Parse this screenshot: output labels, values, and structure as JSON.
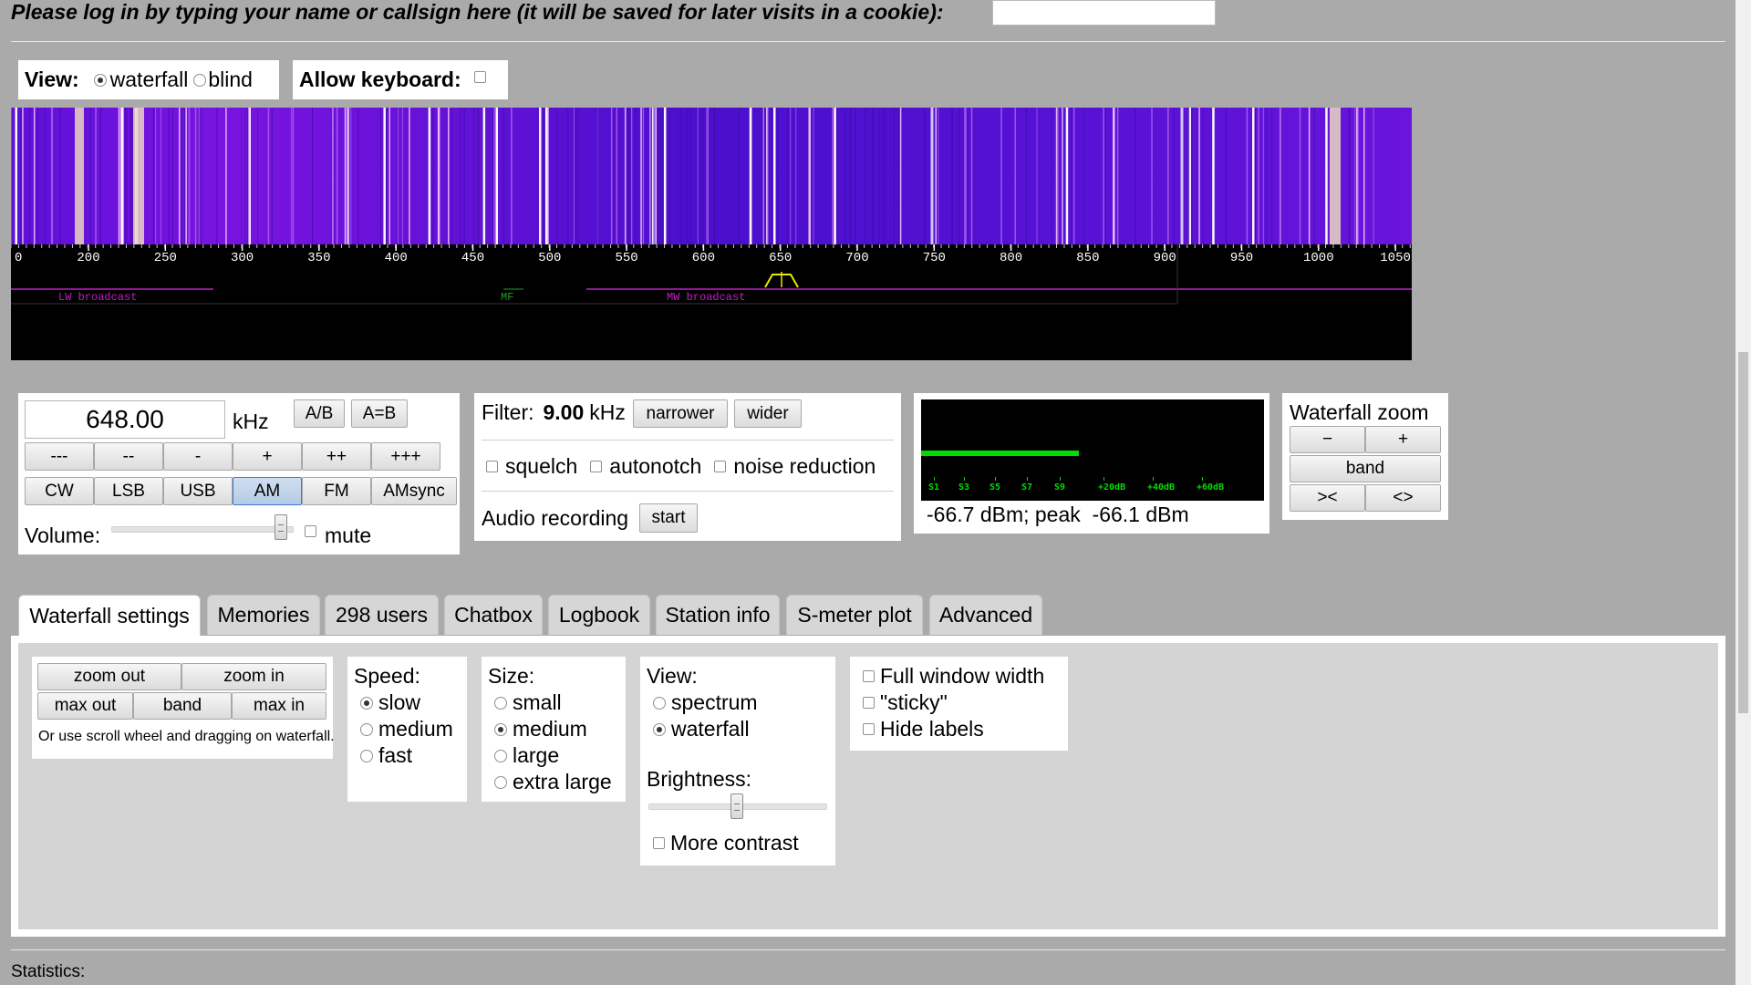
{
  "login": {
    "prompt": "Please log in by typing your name or callsign here (it will be saved for later visits in a cookie):",
    "name_value": ""
  },
  "view_box": {
    "label": "View:",
    "option_waterfall": "waterfall",
    "option_blind": "blind",
    "selected": "waterfall"
  },
  "keyboard_box": {
    "label": "Allow keyboard:",
    "checked": false
  },
  "waterfall": {
    "scale_labels": [
      "0",
      "200",
      "250",
      "300",
      "350",
      "400",
      "450",
      "500",
      "550",
      "600",
      "650",
      "700",
      "750",
      "800",
      "850",
      "900",
      "950",
      "1000",
      "1050"
    ],
    "bands": [
      {
        "label": "LW broadcast",
        "color": "#c020c0"
      },
      {
        "label": "MF",
        "color": "#20a020"
      },
      {
        "label": "MW broadcast",
        "color": "#c020c0"
      }
    ],
    "passband_color": "#e8e800",
    "colors": {
      "background_top": "#5a12d8",
      "band_line": "#d000d0"
    }
  },
  "tuning": {
    "frequency": "648.00",
    "unit": "kHz",
    "ab_label": "A/B",
    "a_eq_b_label": "A=B",
    "step_buttons": [
      "---",
      "--",
      "-",
      "+",
      "++",
      "+++"
    ],
    "mode_buttons": [
      "CW",
      "LSB",
      "USB",
      "AM",
      "FM",
      "AMsync"
    ],
    "active_mode": "AM",
    "volume_label": "Volume:",
    "mute_label": "mute"
  },
  "filter": {
    "label": "Filter:",
    "value": "9.00",
    "unit": "kHz",
    "narrower_label": "narrower",
    "wider_label": "wider",
    "squelch_label": "squelch",
    "autonotch_label": "autonotch",
    "noise_reduction_label": "noise reduction",
    "audio_recording_label": "Audio recording",
    "start_label": "start"
  },
  "smeter": {
    "scale_labels": [
      "S1",
      "S3",
      "S5",
      "S7",
      "S9",
      "+20dB",
      "+40dB",
      "+60dB"
    ],
    "level_fraction": 0.46,
    "reading": "-66.7 dBm; peak  -66.1 dBm",
    "bar_color": "#00dd00"
  },
  "wf_zoom": {
    "title": "Waterfall zoom",
    "minus_label": "−",
    "plus_label": "+",
    "band_label": "band",
    "left_label": "><",
    "right_label": "<>"
  },
  "tabs": [
    "Waterfall settings",
    "Memories",
    "298 users",
    "Chatbox",
    "Logbook",
    "Station info",
    "S-meter plot",
    "Advanced"
  ],
  "active_tab": "Waterfall settings",
  "wf_settings": {
    "zoom_out_label": "zoom out",
    "zoom_in_label": "zoom in",
    "max_out_label": "max out",
    "band_label": "band",
    "max_in_label": "max in",
    "hint": "Or use scroll wheel and dragging on waterfall.",
    "speed": {
      "label": "Speed:",
      "options": [
        "slow",
        "medium",
        "fast"
      ],
      "selected": "slow"
    },
    "size": {
      "label": "Size:",
      "options": [
        "small",
        "medium",
        "large",
        "extra large"
      ],
      "selected": "medium"
    },
    "view": {
      "label": "View:",
      "options": [
        "spectrum",
        "waterfall"
      ],
      "selected": "waterfall"
    },
    "brightness_label": "Brightness:",
    "brightness_level": 0.5,
    "more_contrast_label": "More contrast",
    "full_window_label": "Full window width",
    "sticky_label": "\"sticky\"",
    "hide_labels_label": "Hide labels"
  },
  "statistics_label": "Statistics:"
}
